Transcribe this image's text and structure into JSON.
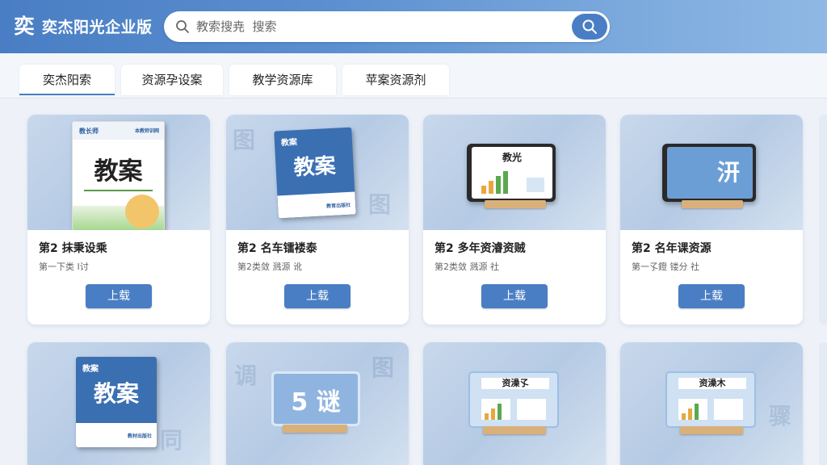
{
  "header": {
    "logo_glyph": "奕",
    "app_title": "奕杰阳光企业版",
    "search_placeholder": "教索搜尭  搜索"
  },
  "tabs": [
    {
      "label": "奕杰阳索",
      "active": true
    },
    {
      "label": "资源孕设案",
      "active": false
    },
    {
      "label": "教学资源库",
      "active": false
    },
    {
      "label": "苹案资源剂",
      "active": false
    }
  ],
  "cards": [
    {
      "title": "第2 抹秉设乘",
      "subtitle": "第一下类 I讨",
      "button": "上载",
      "thumb": {
        "type": "book-white",
        "cover_title": "教案",
        "badge": "教长师",
        "publisher": "本教师训网"
      }
    },
    {
      "title": "第2 名车镭褛泰",
      "subtitle": "第2类敛  溅源 讹",
      "button": "上载",
      "thumb": {
        "type": "book-blue",
        "cover_title": "教案",
        "badge": "教案",
        "publisher": "教育出版社"
      }
    },
    {
      "title": "第2 多年资濬资贼",
      "subtitle": "第2类敛  溅源 社",
      "button": "上载",
      "thumb": {
        "type": "tablet-chart",
        "screen_title": "教光"
      }
    },
    {
      "title": "第2 名年课资源",
      "subtitle": "第一孓鐙  镂分 社",
      "button": "上载",
      "thumb": {
        "type": "tablet-blue",
        "screen_title": "汧"
      }
    },
    {
      "title": "",
      "subtitle": "",
      "button": "",
      "thumb": {
        "type": "book-blue",
        "cover_title": "教案",
        "badge": "教案",
        "publisher": "教材出版社"
      }
    },
    {
      "title": "",
      "subtitle": "",
      "button": "",
      "thumb": {
        "type": "panel-text",
        "screen_title": "5 谜"
      }
    },
    {
      "title": "",
      "subtitle": "",
      "button": "",
      "thumb": {
        "type": "panel-chart",
        "screen_title": "资澡孓"
      }
    },
    {
      "title": "",
      "subtitle": "",
      "button": "",
      "thumb": {
        "type": "panel-chart",
        "screen_title": "资澡木"
      }
    }
  ],
  "colors": {
    "header_start": "#4a7ec4",
    "header_end": "#8fb8e4",
    "accent": "#4a7ec4",
    "book_blue": "#3a6fb2",
    "stand_wood": "#d9b07a"
  },
  "icons": {
    "search_left": "search-icon",
    "search_button": "search-icon"
  }
}
